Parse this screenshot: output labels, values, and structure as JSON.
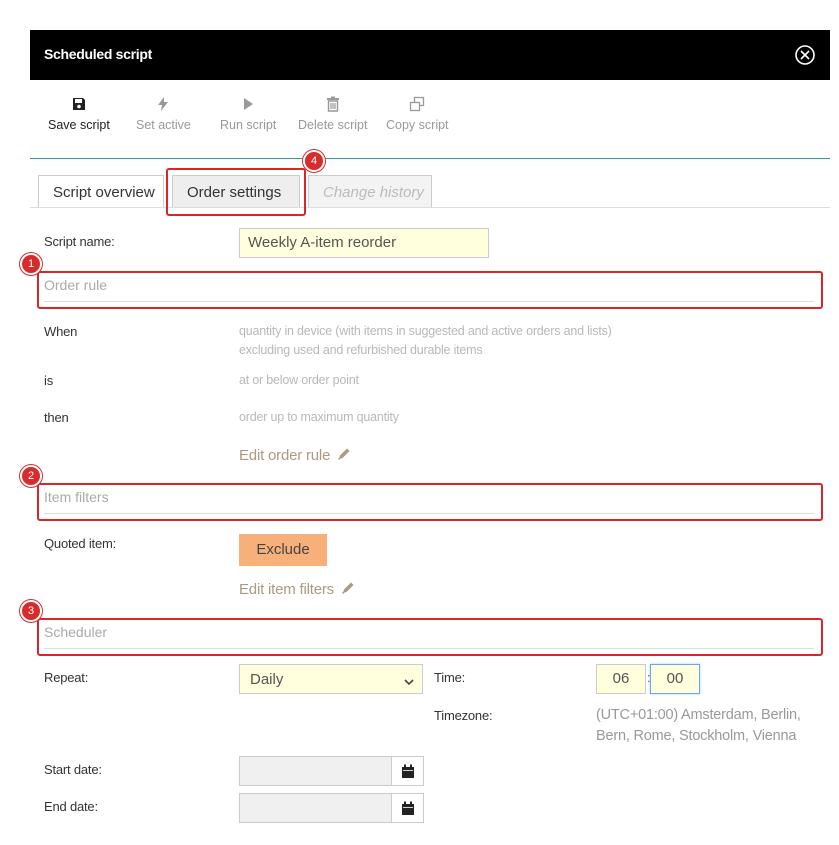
{
  "window": {
    "title": "Scheduled script"
  },
  "toolbar": {
    "save": "Save script",
    "set_active": "Set active",
    "run": "Run script",
    "delete": "Delete script",
    "copy": "Copy script"
  },
  "tabs": {
    "overview": "Script overview",
    "order_settings": "Order settings",
    "history": "Change history"
  },
  "form": {
    "script_name_label": "Script name:",
    "script_name_value": "Weekly A-item reorder"
  },
  "order_rule": {
    "header": "Order rule",
    "when_label": "When",
    "when_value_1": "quantity in device (with items in suggested and active orders and lists)",
    "when_value_2": "excluding used and refurbished durable items",
    "is_label": "is",
    "is_value": "at or below order point",
    "then_label": "then",
    "then_value": "order up to maximum quantity",
    "edit_link": "Edit order rule"
  },
  "item_filters": {
    "header": "Item filters",
    "quoted_label": "Quoted item:",
    "exclude_button": "Exclude",
    "edit_link": "Edit item filters"
  },
  "scheduler": {
    "header": "Scheduler",
    "repeat_label": "Repeat:",
    "repeat_value": "Daily",
    "time_label": "Time:",
    "hour": "06",
    "minute": "00",
    "time_sep": ":",
    "timezone_label": "Timezone:",
    "timezone_line1": "(UTC+01:00) Amsterdam, Berlin,",
    "timezone_line2": "Bern, Rome, Stockholm, Vienna",
    "start_label": "Start date:",
    "end_label": "End date:"
  },
  "annotations": {
    "b1": "1",
    "b2": "2",
    "b3": "3",
    "b4": "4"
  },
  "colors": {
    "accent_line": "#2aa0a0",
    "highlight_red": "#d8262b",
    "exclude_orange": "#f7b07a",
    "field_yellow": "#ffffdd"
  }
}
